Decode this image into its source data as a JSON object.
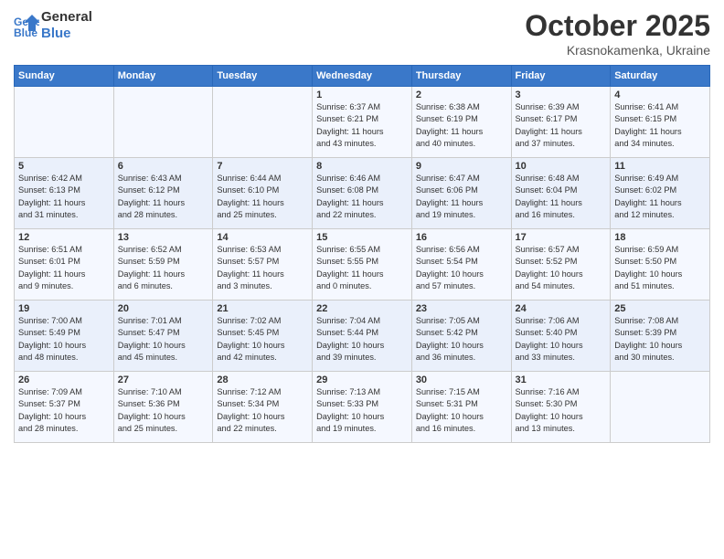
{
  "header": {
    "logo_line1": "General",
    "logo_line2": "Blue",
    "title": "October 2025",
    "subtitle": "Krasnokamenka, Ukraine"
  },
  "days_of_week": [
    "Sunday",
    "Monday",
    "Tuesday",
    "Wednesday",
    "Thursday",
    "Friday",
    "Saturday"
  ],
  "weeks": [
    [
      {
        "day": "",
        "info": ""
      },
      {
        "day": "",
        "info": ""
      },
      {
        "day": "",
        "info": ""
      },
      {
        "day": "1",
        "info": "Sunrise: 6:37 AM\nSunset: 6:21 PM\nDaylight: 11 hours\nand 43 minutes."
      },
      {
        "day": "2",
        "info": "Sunrise: 6:38 AM\nSunset: 6:19 PM\nDaylight: 11 hours\nand 40 minutes."
      },
      {
        "day": "3",
        "info": "Sunrise: 6:39 AM\nSunset: 6:17 PM\nDaylight: 11 hours\nand 37 minutes."
      },
      {
        "day": "4",
        "info": "Sunrise: 6:41 AM\nSunset: 6:15 PM\nDaylight: 11 hours\nand 34 minutes."
      }
    ],
    [
      {
        "day": "5",
        "info": "Sunrise: 6:42 AM\nSunset: 6:13 PM\nDaylight: 11 hours\nand 31 minutes."
      },
      {
        "day": "6",
        "info": "Sunrise: 6:43 AM\nSunset: 6:12 PM\nDaylight: 11 hours\nand 28 minutes."
      },
      {
        "day": "7",
        "info": "Sunrise: 6:44 AM\nSunset: 6:10 PM\nDaylight: 11 hours\nand 25 minutes."
      },
      {
        "day": "8",
        "info": "Sunrise: 6:46 AM\nSunset: 6:08 PM\nDaylight: 11 hours\nand 22 minutes."
      },
      {
        "day": "9",
        "info": "Sunrise: 6:47 AM\nSunset: 6:06 PM\nDaylight: 11 hours\nand 19 minutes."
      },
      {
        "day": "10",
        "info": "Sunrise: 6:48 AM\nSunset: 6:04 PM\nDaylight: 11 hours\nand 16 minutes."
      },
      {
        "day": "11",
        "info": "Sunrise: 6:49 AM\nSunset: 6:02 PM\nDaylight: 11 hours\nand 12 minutes."
      }
    ],
    [
      {
        "day": "12",
        "info": "Sunrise: 6:51 AM\nSunset: 6:01 PM\nDaylight: 11 hours\nand 9 minutes."
      },
      {
        "day": "13",
        "info": "Sunrise: 6:52 AM\nSunset: 5:59 PM\nDaylight: 11 hours\nand 6 minutes."
      },
      {
        "day": "14",
        "info": "Sunrise: 6:53 AM\nSunset: 5:57 PM\nDaylight: 11 hours\nand 3 minutes."
      },
      {
        "day": "15",
        "info": "Sunrise: 6:55 AM\nSunset: 5:55 PM\nDaylight: 11 hours\nand 0 minutes."
      },
      {
        "day": "16",
        "info": "Sunrise: 6:56 AM\nSunset: 5:54 PM\nDaylight: 10 hours\nand 57 minutes."
      },
      {
        "day": "17",
        "info": "Sunrise: 6:57 AM\nSunset: 5:52 PM\nDaylight: 10 hours\nand 54 minutes."
      },
      {
        "day": "18",
        "info": "Sunrise: 6:59 AM\nSunset: 5:50 PM\nDaylight: 10 hours\nand 51 minutes."
      }
    ],
    [
      {
        "day": "19",
        "info": "Sunrise: 7:00 AM\nSunset: 5:49 PM\nDaylight: 10 hours\nand 48 minutes."
      },
      {
        "day": "20",
        "info": "Sunrise: 7:01 AM\nSunset: 5:47 PM\nDaylight: 10 hours\nand 45 minutes."
      },
      {
        "day": "21",
        "info": "Sunrise: 7:02 AM\nSunset: 5:45 PM\nDaylight: 10 hours\nand 42 minutes."
      },
      {
        "day": "22",
        "info": "Sunrise: 7:04 AM\nSunset: 5:44 PM\nDaylight: 10 hours\nand 39 minutes."
      },
      {
        "day": "23",
        "info": "Sunrise: 7:05 AM\nSunset: 5:42 PM\nDaylight: 10 hours\nand 36 minutes."
      },
      {
        "day": "24",
        "info": "Sunrise: 7:06 AM\nSunset: 5:40 PM\nDaylight: 10 hours\nand 33 minutes."
      },
      {
        "day": "25",
        "info": "Sunrise: 7:08 AM\nSunset: 5:39 PM\nDaylight: 10 hours\nand 30 minutes."
      }
    ],
    [
      {
        "day": "26",
        "info": "Sunrise: 7:09 AM\nSunset: 5:37 PM\nDaylight: 10 hours\nand 28 minutes."
      },
      {
        "day": "27",
        "info": "Sunrise: 7:10 AM\nSunset: 5:36 PM\nDaylight: 10 hours\nand 25 minutes."
      },
      {
        "day": "28",
        "info": "Sunrise: 7:12 AM\nSunset: 5:34 PM\nDaylight: 10 hours\nand 22 minutes."
      },
      {
        "day": "29",
        "info": "Sunrise: 7:13 AM\nSunset: 5:33 PM\nDaylight: 10 hours\nand 19 minutes."
      },
      {
        "day": "30",
        "info": "Sunrise: 7:15 AM\nSunset: 5:31 PM\nDaylight: 10 hours\nand 16 minutes."
      },
      {
        "day": "31",
        "info": "Sunrise: 7:16 AM\nSunset: 5:30 PM\nDaylight: 10 hours\nand 13 minutes."
      },
      {
        "day": "",
        "info": ""
      }
    ]
  ]
}
